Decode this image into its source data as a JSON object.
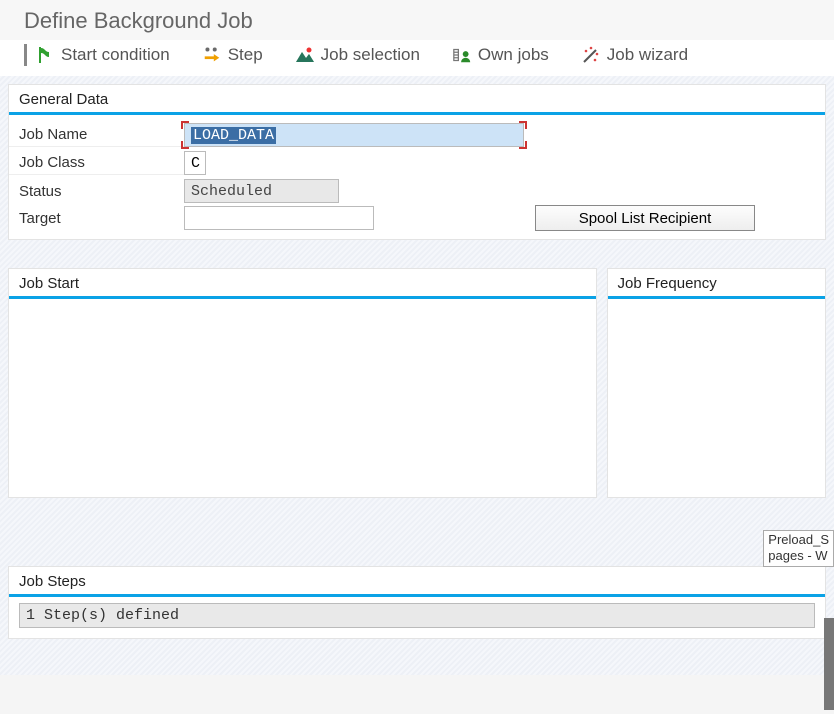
{
  "page": {
    "title": "Define Background Job"
  },
  "toolbar": {
    "start_condition": "Start condition",
    "step": "Step",
    "job_selection": "Job selection",
    "own_jobs": "Own jobs",
    "job_wizard": "Job wizard"
  },
  "general": {
    "title": "General Data",
    "labels": {
      "job_name": "Job Name",
      "job_class": "Job Class",
      "status": "Status",
      "target": "Target"
    },
    "values": {
      "job_name": "LOAD_DATA",
      "job_class": "C",
      "status": "Scheduled",
      "target": ""
    },
    "spool_button": "Spool List Recipient"
  },
  "job_start": {
    "title": "Job Start"
  },
  "job_frequency": {
    "title": "Job Frequency"
  },
  "job_steps": {
    "title": "Job Steps",
    "summary": "1 Step(s) defined"
  },
  "tooltip": {
    "line1": "Preload_S",
    "line2": "pages - W"
  }
}
